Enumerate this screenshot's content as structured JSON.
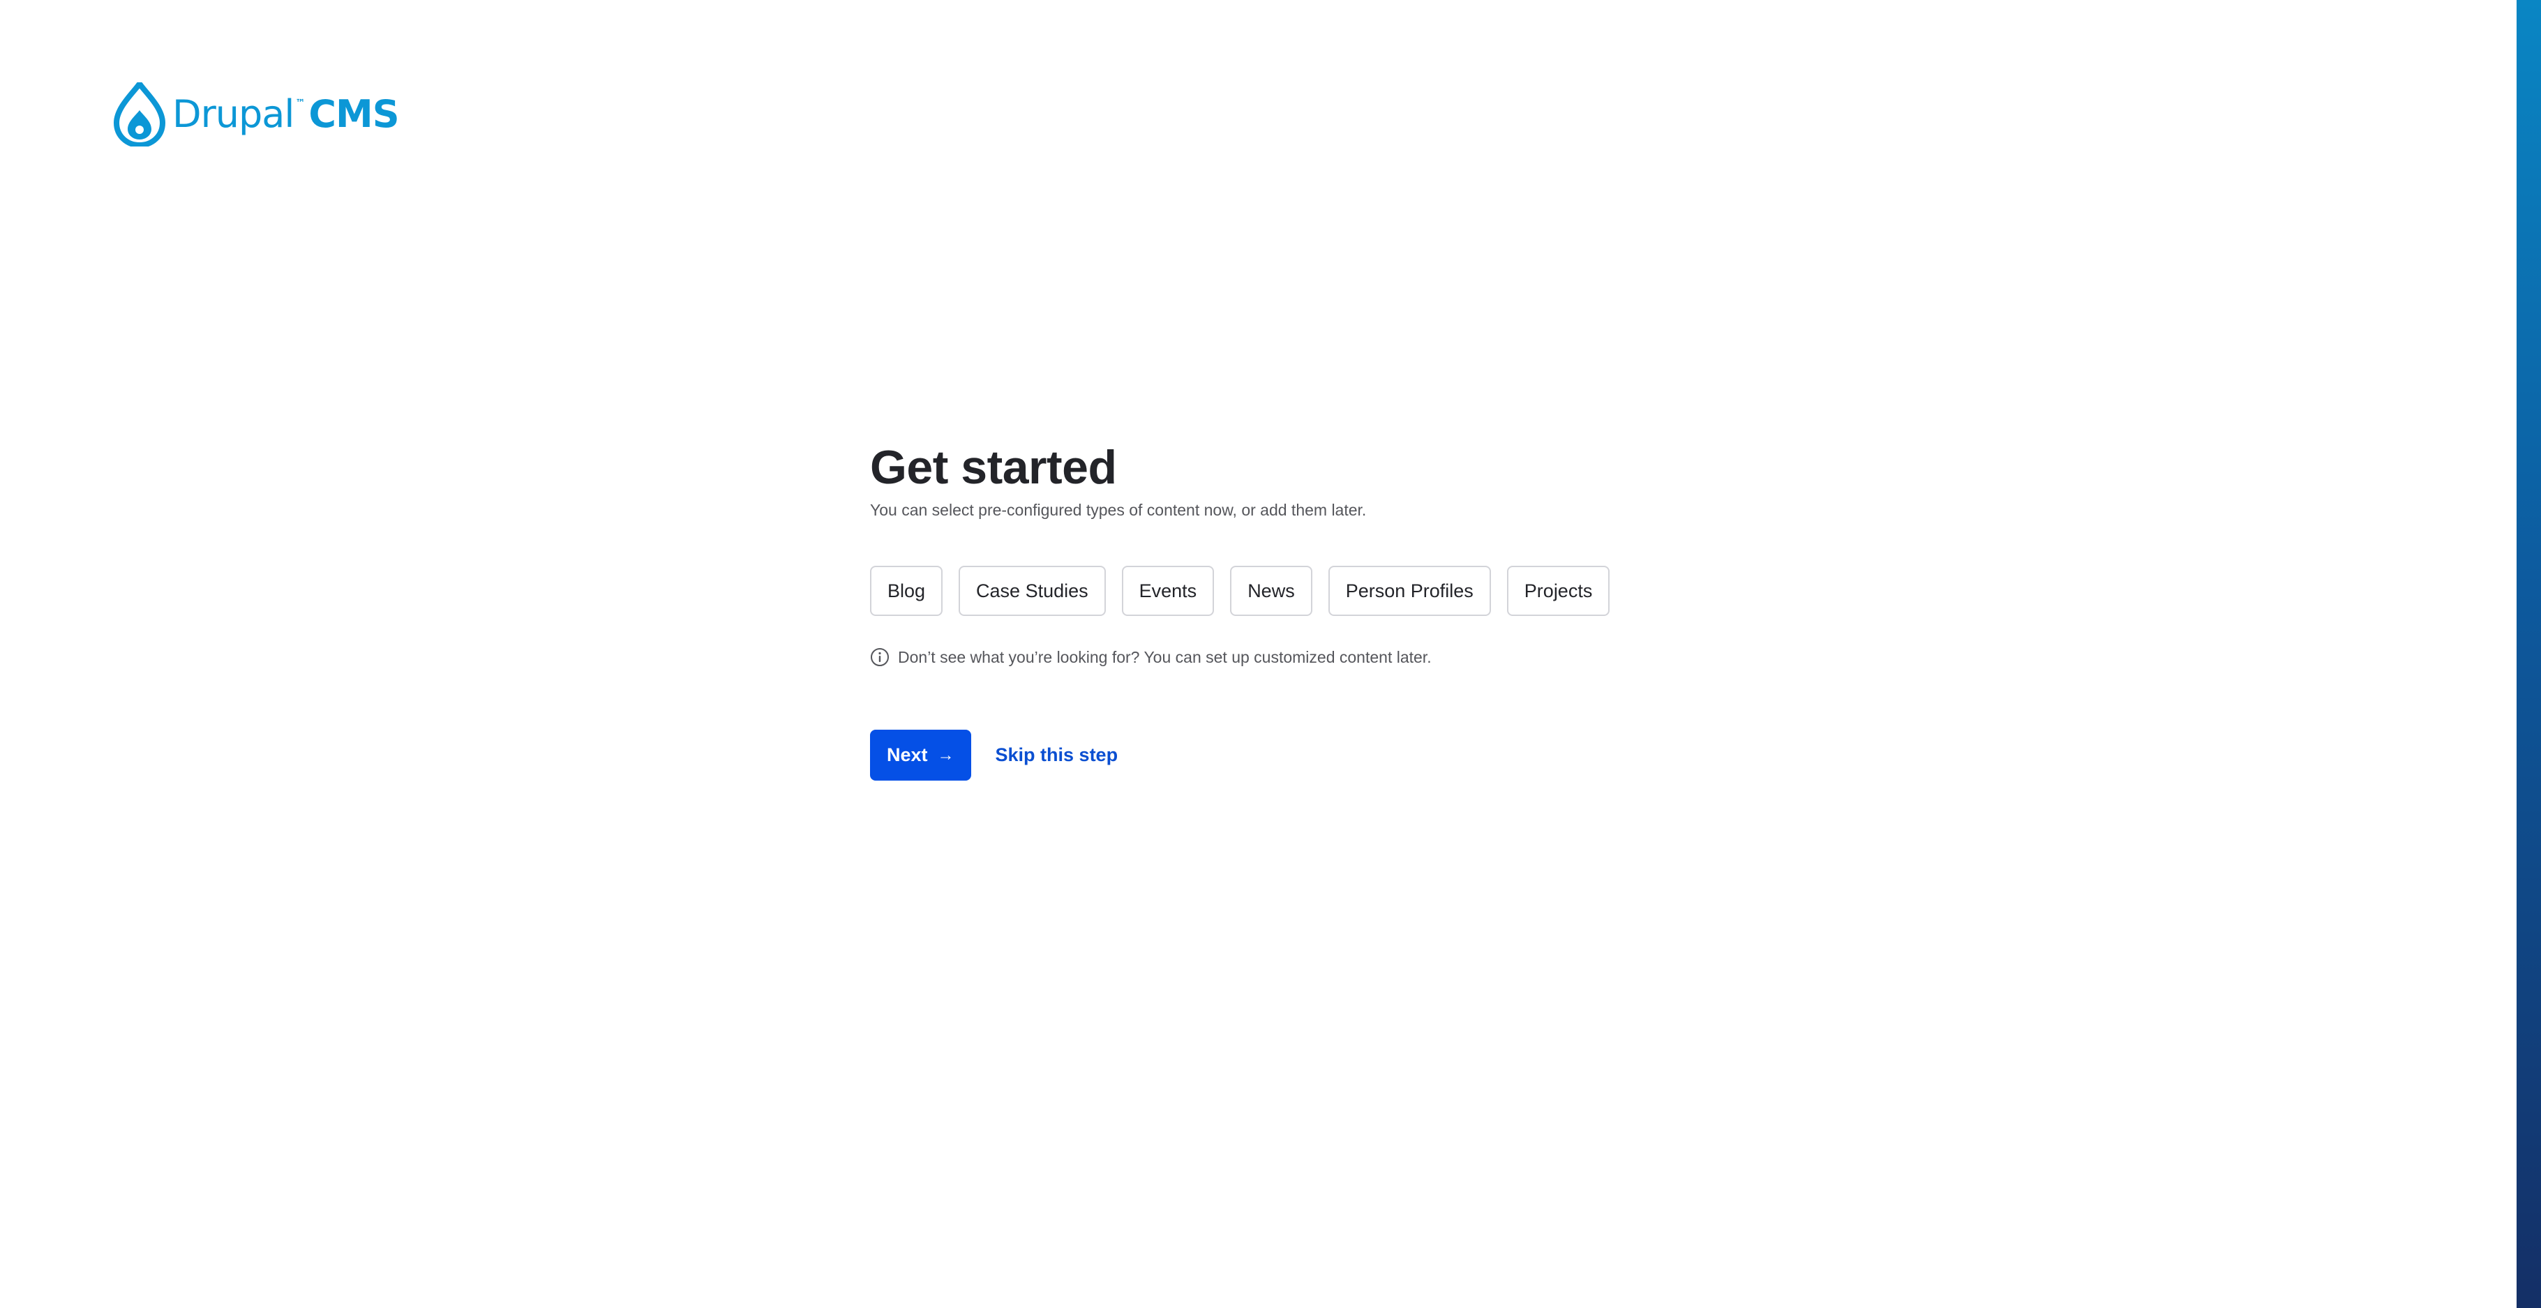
{
  "brand": {
    "name": "Drupal",
    "trademark": "™",
    "product": "CMS",
    "color": "#0c97d6"
  },
  "main": {
    "title": "Get started",
    "subtitle": "You can select pre-configured types of content now, or add them later.",
    "content_types": [
      {
        "label": "Blog"
      },
      {
        "label": "Case Studies"
      },
      {
        "label": "Events"
      },
      {
        "label": "News"
      },
      {
        "label": "Person Profiles"
      },
      {
        "label": "Projects"
      }
    ],
    "hint": {
      "icon": "info-icon",
      "text": "Don’t see what you’re looking for? You can set up customized content later."
    },
    "actions": {
      "next_label": "Next",
      "next_icon": "arrow-right-icon",
      "skip_label": "Skip this step"
    }
  },
  "colors": {
    "primary_button": "#0550e6",
    "link": "#0b4fd1",
    "heading": "#232429",
    "muted_text": "#55565b",
    "chip_border": "#d3d4d9"
  }
}
